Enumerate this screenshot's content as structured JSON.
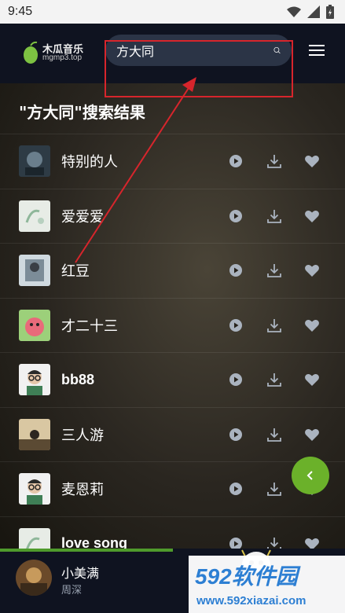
{
  "status_bar": {
    "time": "9:45"
  },
  "header": {
    "logo_title": "木瓜音乐",
    "logo_subtitle": "mgmp3.top",
    "search_value": "方大同"
  },
  "results": {
    "title": "\"方大同\"搜索结果",
    "songs": [
      {
        "title": "特别的人"
      },
      {
        "title": "爱爱爱"
      },
      {
        "title": "红豆"
      },
      {
        "title": "才二十三"
      },
      {
        "title": "bb88"
      },
      {
        "title": "三人游"
      },
      {
        "title": "麦恩莉"
      },
      {
        "title": "love song"
      }
    ]
  },
  "player": {
    "title": "小美满",
    "artist": "周深",
    "progress_fraction": 0.5
  },
  "watermark": {
    "brand": "592软件园",
    "url": "www.592xiazai.com"
  },
  "colors": {
    "accent_green": "#6bb12a",
    "header_bg": "#0f1320",
    "annotation_red": "#d7252c"
  }
}
